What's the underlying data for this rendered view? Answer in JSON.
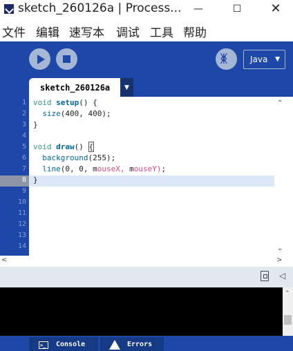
{
  "window": {
    "title": "sketch_260126a | Process...",
    "controls": {
      "minimize": "—",
      "maximize": "☐",
      "close": "✕"
    }
  },
  "menu": [
    "文件",
    "编辑",
    "速写本",
    "调试",
    "工具",
    "帮助"
  ],
  "toolbar": {
    "mode": "Java",
    "mode_arrow": "▼",
    "debug_glyph": "ᛤ"
  },
  "tabs": [
    {
      "label": "sketch_260126a"
    }
  ],
  "tab_menu_arrow": "▼",
  "editor": {
    "line_numbers": [
      "1",
      "2",
      "3",
      "4",
      "5",
      "6",
      "7",
      "8",
      "9",
      "10",
      "11",
      "12",
      "13",
      "14"
    ],
    "current_line": 8,
    "lines": [
      "void setup() {",
      "  size(400, 400);",
      "}",
      "",
      "void draw() {",
      "  background(255);",
      "  line(0, 0, mouseX, mouseY);",
      "}"
    ]
  },
  "bottom_tabs": {
    "console": "Console",
    "errors": "Errors"
  },
  "colors": {
    "toolbar_blue": "#1e48a8",
    "tab_dark": "#163a86",
    "keyword": "#33997e",
    "function": "#006699",
    "variable": "#d94a7a"
  }
}
